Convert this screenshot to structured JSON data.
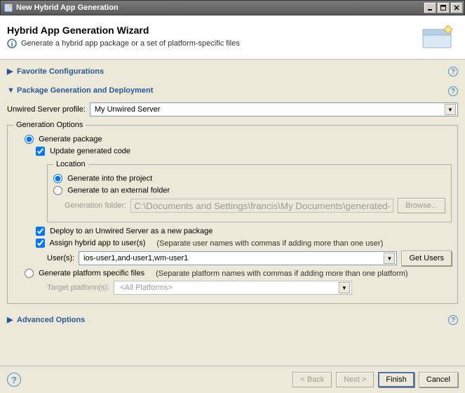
{
  "window": {
    "title": "New Hybrid App Generation"
  },
  "banner": {
    "title": "Hybrid App Generation Wizard",
    "description": "Generate a hybrid app package or a set of platform-specific files"
  },
  "sections": {
    "favorite": {
      "title": "Favorite Configurations"
    },
    "package": {
      "title": "Package Generation and Deployment"
    },
    "advanced": {
      "title": "Advanced Options"
    }
  },
  "profile": {
    "label": "Unwired Server profile:",
    "value": "My Unwired Server"
  },
  "genOptions": {
    "legend": "Generation Options",
    "generatePackage": "Generate package",
    "updateCode": "Update generated code",
    "location": {
      "legend": "Location",
      "intoProject": "Generate into the project",
      "external": "Generate to an external folder",
      "folderLabel": "Generation folder:",
      "folderValue": "C:\\Documents and Settings\\francis\\My Documents\\generated-external",
      "browse": "Browse..."
    },
    "deploy": "Deploy to an Unwired Server as a new package",
    "assign": {
      "label": "Assign hybrid app to user(s)",
      "hint": "(Separate user names with commas if adding more than one user)",
      "usersLabel": "User(s):",
      "usersValue": "ios-user1,and-user1,wm-user1",
      "getUsers": "Get Users"
    },
    "platformSpecific": {
      "label": "Generate platform specific files",
      "hint": "(Separate platform names with commas if adding more than one platform)",
      "targetLabel": "Target platform(s):",
      "targetValue": "<All Platforms>"
    }
  },
  "buttons": {
    "back": "< Back",
    "next": "Next >",
    "finish": "Finish",
    "cancel": "Cancel"
  }
}
